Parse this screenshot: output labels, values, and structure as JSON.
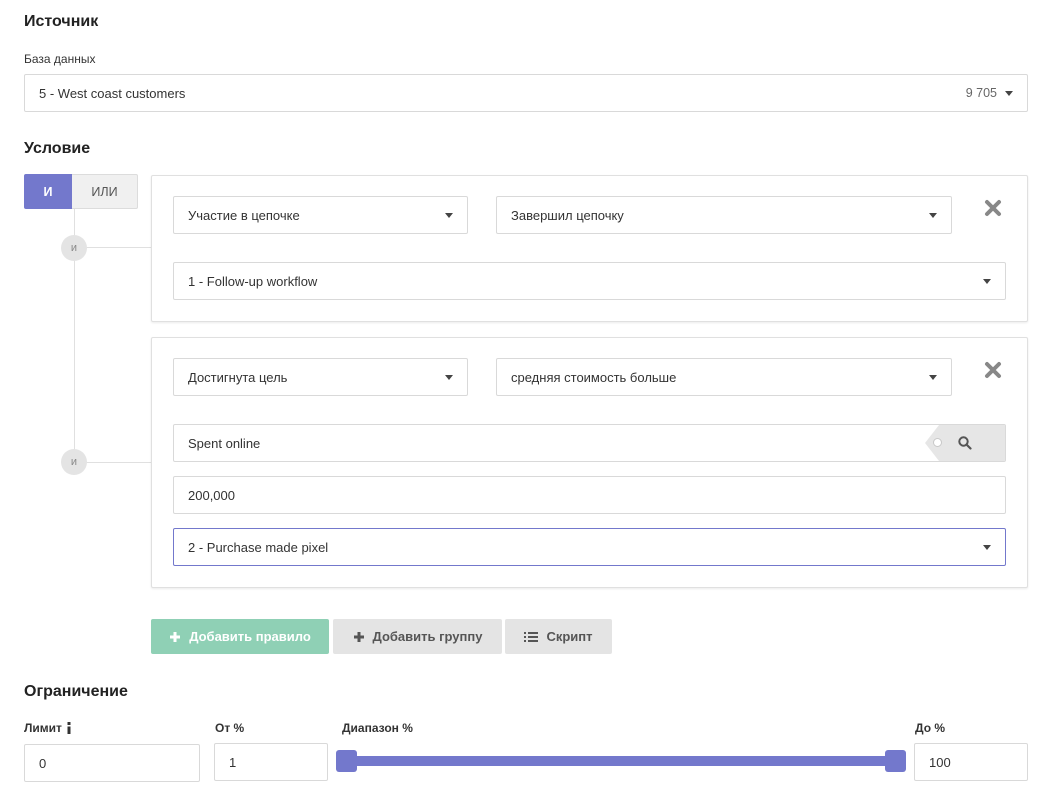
{
  "source": {
    "heading": "Источник",
    "db_label": "База данных",
    "db_value": "5 - West coast customers",
    "db_count": "9 705"
  },
  "condition": {
    "heading": "Условие",
    "toggle_and": "И",
    "toggle_or": "ИЛИ",
    "node_label": "и",
    "rules": [
      {
        "type": "Участие в цепочке",
        "operator": "Завершил цепочку",
        "workflow": "1 - Follow-up workflow"
      },
      {
        "type": "Достигнута цель",
        "operator": "средняя стоимость больше",
        "field": "Spent online",
        "value": "200,000",
        "pixel": "2 - Purchase made pixel"
      }
    ]
  },
  "actions": {
    "add_rule": "Добавить правило",
    "add_group": "Добавить группу",
    "script": "Скрипт"
  },
  "limit": {
    "heading": "Ограничение",
    "limit_label": "Лимит",
    "limit_value": "0",
    "from_label": "От %",
    "from_value": "1",
    "range_label": "Диапазон %",
    "to_label": "До %",
    "to_value": "100",
    "range": [
      1,
      100
    ]
  },
  "colors": {
    "accent": "#7378cc",
    "success": "#8fd0b5"
  }
}
